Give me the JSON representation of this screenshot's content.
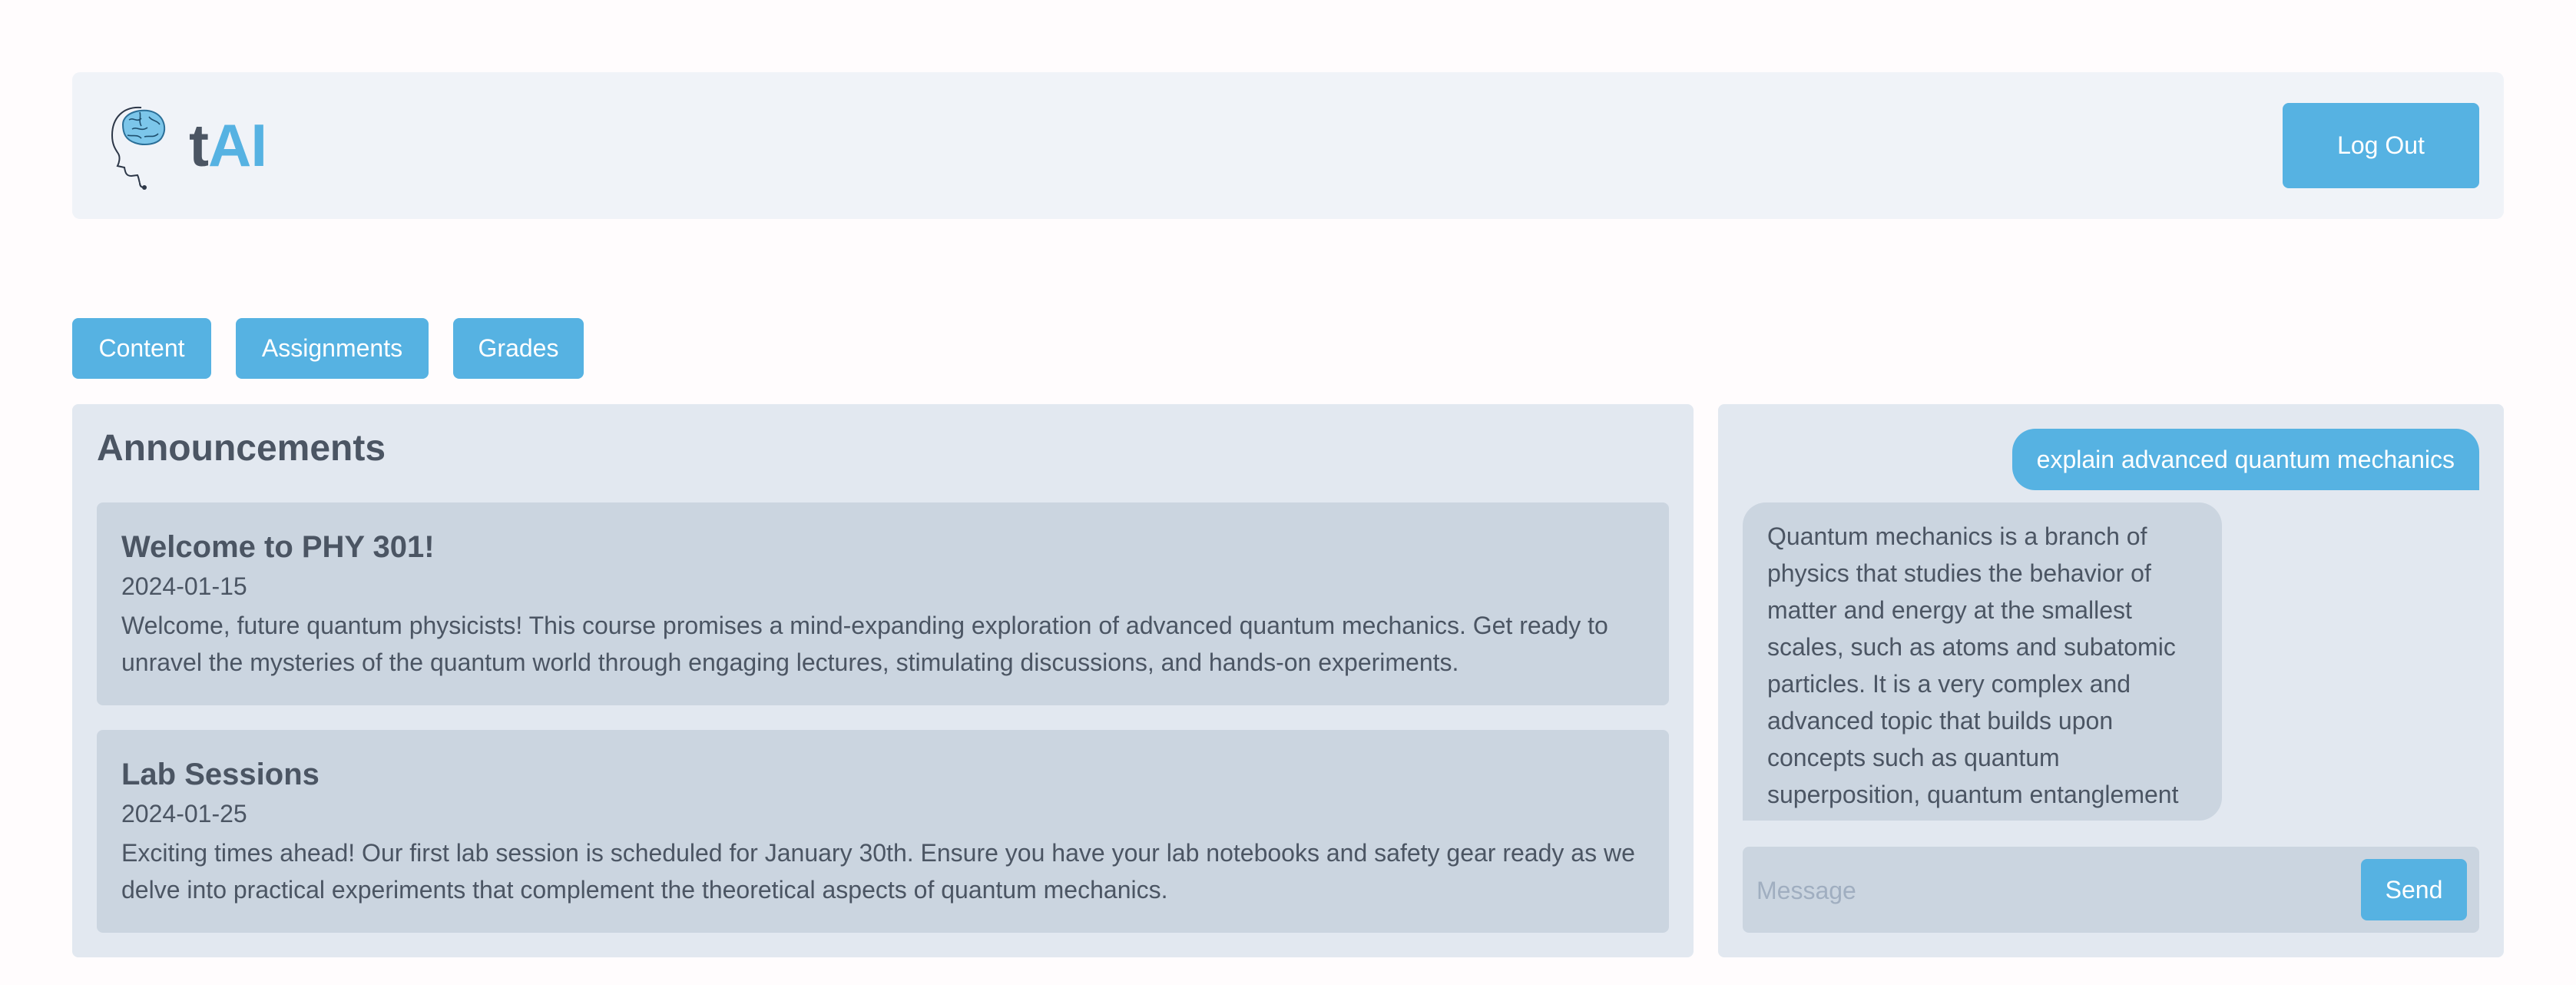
{
  "brand": {
    "prefix": "t",
    "accent": "AI",
    "logo_icon": "brain-head-icon"
  },
  "header": {
    "logout_label": "Log Out"
  },
  "tabs": [
    {
      "label": "Content"
    },
    {
      "label": "Assignments"
    },
    {
      "label": "Grades"
    }
  ],
  "announcements": {
    "title": "Announcements",
    "items": [
      {
        "title": "Welcome to PHY 301!",
        "date": "2024-01-15",
        "body": "Welcome, future quantum physicists! This course promises a mind-expanding exploration of advanced quantum mechanics. Get ready to unravel the mysteries of the quantum world through engaging lectures, stimulating discussions, and hands-on experiments."
      },
      {
        "title": "Lab Sessions",
        "date": "2024-01-25",
        "body": "Exciting times ahead! Our first lab session is scheduled for January 30th. Ensure you have your lab notebooks and safety gear ready as we delve into practical experiments that complement the theoretical aspects of quantum mechanics."
      }
    ]
  },
  "chat": {
    "messages": [
      {
        "role": "user",
        "text": "explain advanced quantum mechanics"
      },
      {
        "role": "assistant",
        "text": "Quantum mechanics is a branch of physics that studies the behavior of matter and energy at the smallest scales, such as atoms and subatomic particles. It is a very complex and advanced topic that builds upon concepts such as quantum superposition, quantum entanglement"
      }
    ],
    "input": {
      "value": "",
      "placeholder": "Message"
    },
    "send_label": "Send"
  },
  "colors": {
    "accent": "#56b2e2",
    "panel": "#e2e8f0",
    "card": "#cbd5e0",
    "text": "#4b5563",
    "header_bg": "#f0f3f8"
  }
}
